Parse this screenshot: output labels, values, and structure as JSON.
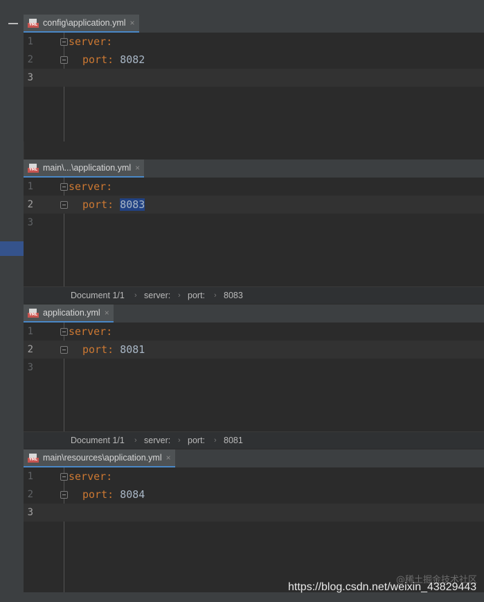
{
  "panes": [
    {
      "tab": "config\\application.yml",
      "lines": [
        {
          "num": "1",
          "key": "server",
          "indent": 0,
          "value": ""
        },
        {
          "num": "2",
          "key": "port",
          "indent": 1,
          "value": "8082"
        },
        {
          "num": "3",
          "key": "",
          "indent": 0,
          "value": ""
        }
      ],
      "breadcrumb": null
    },
    {
      "tab": "main\\...\\application.yml",
      "lines": [
        {
          "num": "1",
          "key": "server",
          "indent": 0,
          "value": ""
        },
        {
          "num": "2",
          "key": "port",
          "indent": 1,
          "value": "8083"
        },
        {
          "num": "3",
          "key": "",
          "indent": 0,
          "value": ""
        }
      ],
      "breadcrumb": {
        "doc": "Document 1/1",
        "a": "server:",
        "b": "port:",
        "c": "8083"
      }
    },
    {
      "tab": "application.yml",
      "lines": [
        {
          "num": "1",
          "key": "server",
          "indent": 0,
          "value": ""
        },
        {
          "num": "2",
          "key": "port",
          "indent": 1,
          "value": "8081"
        },
        {
          "num": "3",
          "key": "",
          "indent": 0,
          "value": ""
        }
      ],
      "breadcrumb": {
        "doc": "Document 1/1",
        "a": "server:",
        "b": "port:",
        "c": "8081"
      }
    },
    {
      "tab": "main\\resources\\application.yml",
      "lines": [
        {
          "num": "1",
          "key": "server",
          "indent": 0,
          "value": ""
        },
        {
          "num": "2",
          "key": "port",
          "indent": 1,
          "value": "8084"
        },
        {
          "num": "3",
          "key": "",
          "indent": 0,
          "value": ""
        }
      ],
      "breadcrumb": null
    }
  ],
  "file_icon_label": "YML",
  "close_glyph": "×",
  "colon": ":",
  "breadcrumb_sep": "›",
  "watermark": "@稀土掘金技术社区",
  "watermark_url": "https://blog.csdn.net/weixin_43829443",
  "colors": {
    "key": "#cc7832",
    "value": "#a9b7c6",
    "selection": "#214283",
    "tab_underline": "#4a88c7"
  }
}
